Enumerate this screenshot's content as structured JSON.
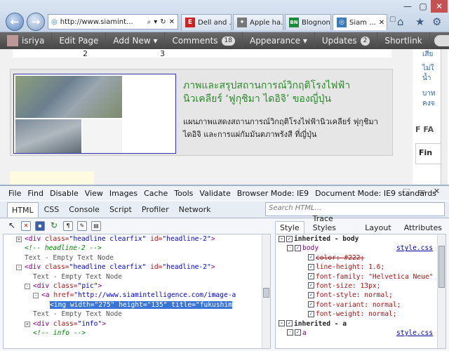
{
  "browser": {
    "address": "http://www.siamint...",
    "tabs": [
      {
        "label": "Dell and ...",
        "icon": "E",
        "color": "#cc2222"
      },
      {
        "label": "Apple ha...",
        "icon": "✦",
        "color": "#555555"
      },
      {
        "label": "Blognon...",
        "icon": "BN",
        "color": "#1a8a3a"
      },
      {
        "label": "Siam ...",
        "icon": "◎",
        "color": "#3a7ab8"
      }
    ]
  },
  "adminbar": {
    "user": "isriya",
    "items": [
      {
        "label": "Edit Page"
      },
      {
        "label": "Add New ▾"
      },
      {
        "label": "Comments",
        "badge": "18"
      },
      {
        "label": "Appearance ▾"
      },
      {
        "label": "Updates",
        "badge": "2"
      },
      {
        "label": "Shortlink"
      }
    ]
  },
  "page": {
    "counts": [
      "2",
      "3"
    ],
    "headline": "ภาพและสรุปสถานการณ์วิกฤติโรงไฟฟ้านิวเคลียร์ ‘ฟูกุชิมา ไดอิจิ’ ของญี่ปุ่น",
    "excerpt": "แผนภาพแสดงสถานการณ์วิกฤติโรงไฟฟ้านิวเคลียร์ ฟุกุชิมา ไดอิจิ และการแผ่กัมมันตภาพรังสี ที่ญี่ปุ่น",
    "sidebar_snippets": [
      "เสีย",
      "ไม่ใ",
      "น้ำ",
      "บาท",
      "คงจ",
      "F FA",
      "Fin"
    ]
  },
  "devtools": {
    "menu": [
      "File",
      "Find",
      "Disable",
      "View",
      "Images",
      "Cache",
      "Tools",
      "Validate",
      "Browser Mode: IE9",
      "Document Mode: IE9 standards"
    ],
    "tabs": [
      "HTML",
      "CSS",
      "Console",
      "Script",
      "Profiler",
      "Network"
    ],
    "search_placeholder": "Search HTML...",
    "style_tabs": [
      "Style",
      "Trace Styles",
      "Layout",
      "Attributes"
    ],
    "html_lines": [
      {
        "indent": 3,
        "exp": "+",
        "html": "<span class=\"tagc\">&lt;div</span> <span class=\"attrc\">class=</span><span class=\"valc\">\"headline clearfix\"</span> <span class=\"attrc\">id=</span><span class=\"valc\">\"headline-2\"</span><span class=\"tagc\">&gt;</span>"
      },
      {
        "indent": 3,
        "exp": "",
        "html": "<span class=\"cmt\">&lt;!-- headline-2 --&gt;</span>"
      },
      {
        "indent": 3,
        "exp": "",
        "html": "<span class=\"txt\">Text - Empty Text Node</span>"
      },
      {
        "indent": 3,
        "exp": "-",
        "html": "<span class=\"tagc\">&lt;div</span> <span class=\"attrc\">class=</span><span class=\"valc\">\"headline clearfix\"</span> <span class=\"attrc\">id=</span><span class=\"valc\">\"headline-2\"</span><span class=\"tagc\">&gt;</span>"
      },
      {
        "indent": 5,
        "exp": "",
        "html": "<span class=\"txt\">Text - Empty Text Node</span>"
      },
      {
        "indent": 5,
        "exp": "-",
        "html": "<span class=\"tagc\">&lt;div</span> <span class=\"attrc\">class=</span><span class=\"valc\">\"pic\"</span><span class=\"tagc\">&gt;</span>"
      },
      {
        "indent": 7,
        "exp": "-",
        "html": "<span class=\"tagc\">&lt;a</span> <span class=\"attrc\">href=</span><span class=\"valc\">\"http://www.siamintelligence.com/image-a</span>"
      },
      {
        "indent": 9,
        "exp": "",
        "sel": true,
        "html": "&lt;img width=\"275\" height=\"135\" title=\"fukushim"
      },
      {
        "indent": 5,
        "exp": "",
        "html": "<span class=\"txt\">Text - Empty Text Node</span>"
      },
      {
        "indent": 5,
        "exp": "+",
        "html": "<span class=\"tagc\">&lt;div</span> <span class=\"attrc\">class=</span><span class=\"valc\">\"info\"</span><span class=\"tagc\">&gt;</span>"
      },
      {
        "indent": 5,
        "exp": "",
        "html": "<span class=\"cmt\">&lt;!-- info --&gt;</span>"
      }
    ],
    "style_lines": [
      {
        "type": "head",
        "text": "inherited - body",
        "exp": "-"
      },
      {
        "type": "sel",
        "text": "body",
        "file": "style.css"
      },
      {
        "type": "prop",
        "text": "color: #222;",
        "strike": true
      },
      {
        "type": "prop",
        "text": "line-height: 1.6;"
      },
      {
        "type": "prop",
        "text": "font-family: \"Helvetica Neue\""
      },
      {
        "type": "prop",
        "text": "font-size: 13px;"
      },
      {
        "type": "prop",
        "text": "font-style: normal;"
      },
      {
        "type": "prop",
        "text": "font-variant: normal;"
      },
      {
        "type": "prop",
        "text": "font-weight: normal;"
      },
      {
        "type": "head",
        "text": "inherited - a",
        "exp": "-"
      },
      {
        "type": "sel",
        "text": "a",
        "file": "style.css"
      }
    ]
  }
}
